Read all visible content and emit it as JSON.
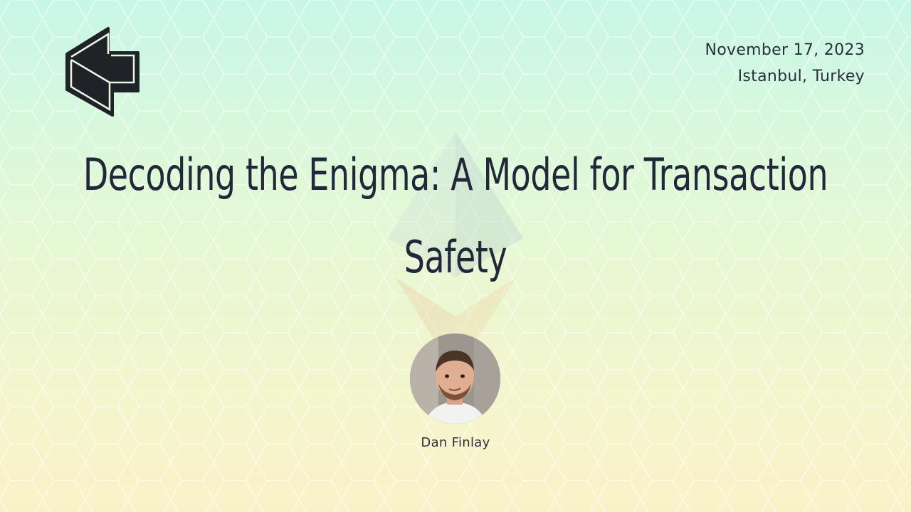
{
  "slide": {
    "date": "November 17, 2023",
    "location": "Istanbul, Turkey",
    "title": "Decoding the Enigma: A Model for Transaction Safety",
    "speaker_name": "Dan Finlay"
  },
  "icons": {
    "logo": "devcon-logo-icon",
    "watermark": "ethereum-diamond-icon",
    "avatar": "speaker-avatar"
  },
  "colors": {
    "text": "#22283a",
    "bg_top": "#c8f7e7",
    "bg_bottom": "#fbf1c8"
  }
}
